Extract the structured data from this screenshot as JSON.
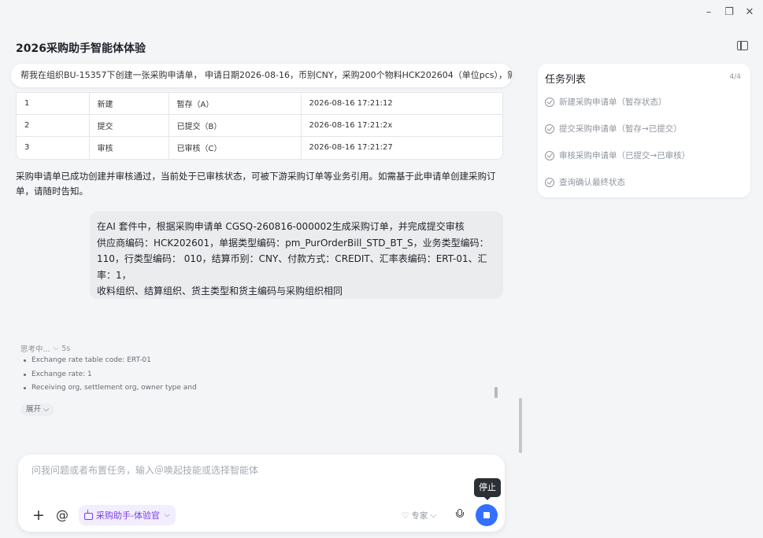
{
  "window": {
    "minimize": "–",
    "restore": "❐",
    "close": "✕"
  },
  "title": "2026采购助手智能体体验",
  "prompt": "帮我在组织BU-15357下创建一张采购申请单， 申请日期2026-08-16，币别CNY，采购200个物料HCK202604（单位pcs），需...",
  "status_table": {
    "rows": [
      [
        "1",
        "新建",
        "暂存（A）",
        "2026-08-16 17:21:12"
      ],
      [
        "2",
        "提交",
        "已提交（B）",
        "2026-08-16 17:21:2x"
      ],
      [
        "3",
        "审核",
        "已审核（C）",
        "2026-08-16 17:21:27"
      ]
    ]
  },
  "reply": "采购申请单已成功创建并审核通过，当前处于已审核状态，可被下游采购订单等业务引用。如需基于此申请单创建采购订单，请随时告知。",
  "user_message": {
    "line1": "在AI 套件中，根据采购申请单 CGSQ-260816-000002生成采购订单，并完成提交审核",
    "line2": "供应商编码：HCK202601，单据类型编码：pm_PurOrderBill_STD_BT_S，业务类型编码：",
    "line3": "110，行类型编码： 010，结算币别：CNY、付款方式：CREDIT、汇率表编码：ERT-01、汇",
    "line4": "率：1，",
    "line5": "收料组织、结算组织、货主类型和货主编码与采购组织相同"
  },
  "thinking": {
    "label": "思考中...",
    "duration": "5s",
    "items": [
      "Exchange rate table code: ERT-01",
      "Exchange rate: 1",
      "Receiving org, settlement org, owner type and"
    ],
    "expand_label": "展开"
  },
  "tasks": {
    "title": "任务列表",
    "count": "4/4",
    "items": [
      "新建采购申请单（暂存状态）",
      "提交采购申请单（暂存→已提交）",
      "审核采购申请单（已提交→已审核）",
      "查询确认最终状态"
    ]
  },
  "composer": {
    "placeholder": "问我问题或者布置任务，输入＠唤起技能或选择智能体",
    "agent_label": "采购助手-体验官",
    "expert_label": "专家",
    "stop_tooltip": "停止"
  },
  "colors": {
    "accent": "#3370ff",
    "agent_chip": "#7b3fe4"
  }
}
